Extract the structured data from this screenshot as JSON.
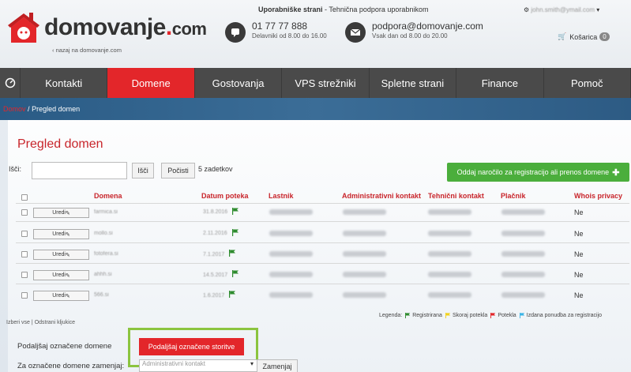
{
  "header": {
    "logo": {
      "name": "domovanje",
      "dot": ".",
      "tld": "com"
    },
    "back_link": "nazaj na domovanje.com",
    "tagline_bold": "Uporabniške strani",
    "tagline_rest": " - Tehnična podpora uporabnikom",
    "phone": {
      "number": "01 77 77 888",
      "hours": "Delavniki od 8.00 do 16.00"
    },
    "email": {
      "address": "podpora@domovanje.com",
      "hours": "Vsak dan od 8.00 do 20.00"
    },
    "user": "john.smith@ymail.com",
    "cart": {
      "label": "Košarica",
      "count": "0"
    }
  },
  "nav": {
    "items": [
      "Kontakti",
      "Domene",
      "Gostovanja",
      "VPS strežniki",
      "Spletne strani",
      "Finance",
      "Pomoč"
    ],
    "active": "Domene"
  },
  "breadcrumb": {
    "first": "Domov",
    "sep": "/",
    "current": "Pregled domen"
  },
  "page": {
    "title": "Pregled domen",
    "search_label": "Išči:",
    "search_button": "Išči",
    "clear_button": "Počisti",
    "count": "5 zadetkov",
    "order_button": "Oddaj naročilo za registracijo ali prenos domene"
  },
  "table": {
    "columns": [
      "Domena",
      "Datum poteka",
      "Lastnik",
      "Administrativni kontakt",
      "Tehnični kontakt",
      "Plačnik",
      "Whois privacy"
    ],
    "edit_label": "Uredi",
    "rows": [
      {
        "domain": "farmica.si",
        "expiry": "31.8.2016",
        "whois": "Ne"
      },
      {
        "domain": "mollo.si",
        "expiry": "2.11.2016",
        "whois": "Ne"
      },
      {
        "domain": "fotofera.si",
        "expiry": "7.1.2017",
        "whois": "Ne"
      },
      {
        "domain": "ahhh.si",
        "expiry": "14.5.2017",
        "whois": "Ne"
      },
      {
        "domain": "566.si",
        "expiry": "1.6.2017",
        "whois": "Ne"
      }
    ]
  },
  "footer": {
    "select_all": "Izberi vse",
    "select_sep": " | ",
    "clear_selection": "Odstrani kljukice",
    "legend_title": "Legenda:",
    "legend": [
      {
        "label": "Registrirana",
        "color": "#2e8b2e"
      },
      {
        "label": "Skoraj potekla",
        "color": "#f2d21b"
      },
      {
        "label": "Potekla",
        "color": "#e3262a"
      },
      {
        "label": "Izdana ponudba za registracijo",
        "color": "#3bb4e6"
      }
    ],
    "renew_label": "Podaljšaj označene domene",
    "renew_button": "Podaljšaj označene storitve",
    "replace_label": "Za označene domene zamenjaj:",
    "replace_select": "Administrativni kontakt",
    "replace_button": "Zamenjaj"
  },
  "colors": {
    "brand_red": "#e3262a",
    "nav_bg": "#4a4a4a",
    "green": "#4bae3c",
    "highlight": "#8bc43f"
  }
}
